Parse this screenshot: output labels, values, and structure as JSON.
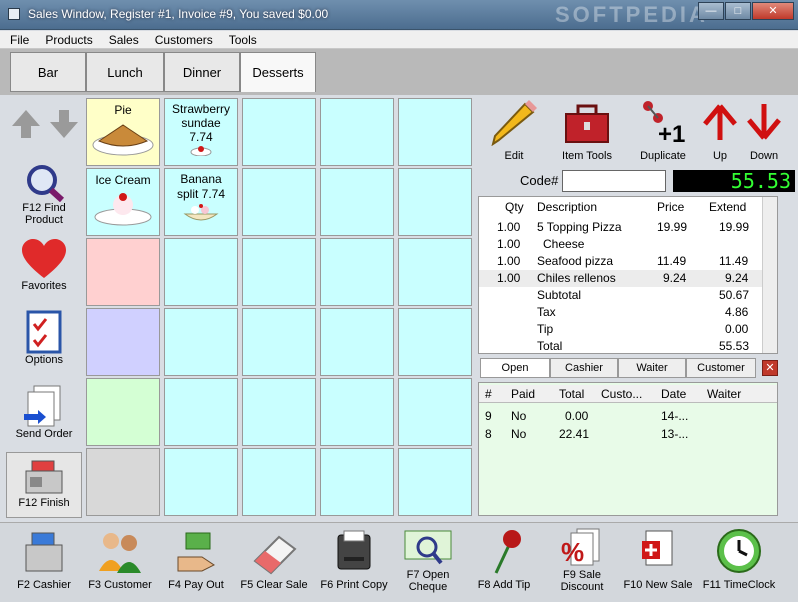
{
  "window": {
    "title": "Sales Window,  Register #1,  Invoice #9, You saved $0.00",
    "watermark": "SOFTPEDIA"
  },
  "menu": [
    "File",
    "Products",
    "Sales",
    "Customers",
    "Tools"
  ],
  "categories": [
    "Bar",
    "Lunch",
    "Dinner",
    "Desserts"
  ],
  "left": {
    "find": "F12 Find Product",
    "favorites": "Favorites",
    "options": "Options",
    "send": "Send Order",
    "finish": "F12 Finish"
  },
  "products": {
    "pie": "Pie",
    "icecream": "Ice Cream",
    "strawberry": "Strawberry sundae",
    "strawberry_price": "7.74",
    "banana": "Banana split 7.74"
  },
  "tools": {
    "edit": "Edit",
    "itemtools": "Item Tools",
    "duplicate": "Duplicate",
    "up": "Up",
    "down": "Down"
  },
  "code": {
    "label": "Code#",
    "total": "55.53"
  },
  "order": {
    "headers": {
      "qty": "Qty",
      "desc": "Description",
      "price": "Price",
      "extend": "Extend"
    },
    "rows": [
      {
        "qty": "1.00",
        "desc": "5 Topping Pizza",
        "price": "19.99",
        "extend": "19.99"
      },
      {
        "qty": "1.00",
        "desc": "Cheese",
        "price": "",
        "extend": ""
      },
      {
        "qty": "1.00",
        "desc": "Seafood pizza",
        "price": "11.49",
        "extend": "11.49"
      },
      {
        "qty": "1.00",
        "desc": "Chiles rellenos",
        "price": "9.24",
        "extend": "9.24"
      }
    ],
    "totals": [
      {
        "label": "Subtotal",
        "value": "50.67"
      },
      {
        "label": "Tax",
        "value": "4.86"
      },
      {
        "label": "Tip",
        "value": "0.00"
      },
      {
        "label": "Total",
        "value": "55.53"
      }
    ]
  },
  "tabs": [
    "Open",
    "Cashier",
    "Waiter",
    "Customer"
  ],
  "invoices": {
    "headers": {
      "num": "#",
      "paid": "Paid",
      "total": "Total",
      "cust": "Custo...",
      "date": "Date",
      "waiter": "Waiter"
    },
    "rows": [
      {
        "num": "9",
        "paid": "No",
        "total": "0.00",
        "date": "14-..."
      },
      {
        "num": "8",
        "paid": "No",
        "total": "22.41",
        "date": "13-..."
      }
    ]
  },
  "fkeys": [
    "F2 Cashier",
    "F3 Customer",
    "F4 Pay Out",
    "F5 Clear Sale",
    "F6 Print Copy",
    "F7 Open Cheque",
    "F8 Add Tip",
    "F9 Sale Discount",
    "F10 New Sale",
    "F11 TimeClock"
  ]
}
